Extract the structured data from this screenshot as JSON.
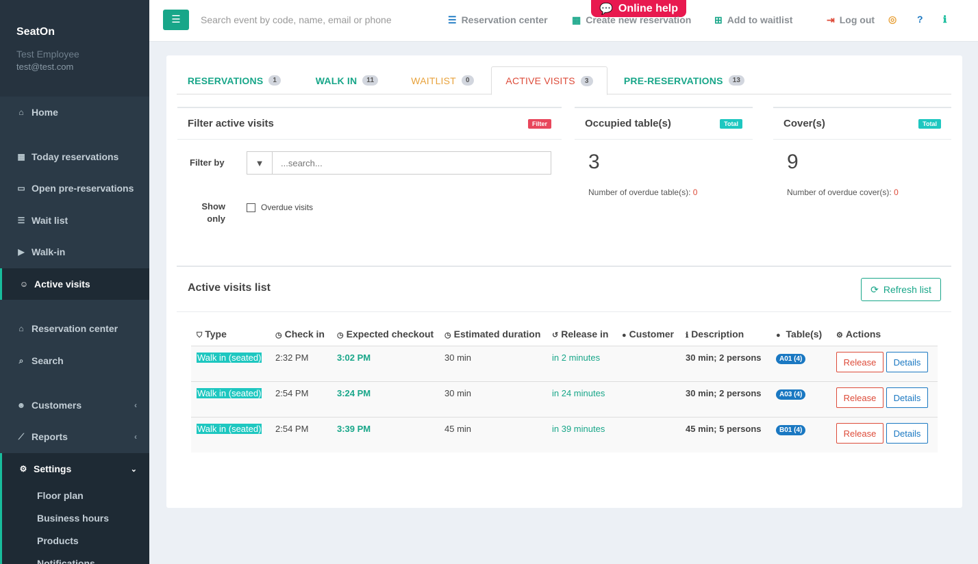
{
  "sidebar": {
    "app_name": "SeatOn",
    "user_role": "Test Employee",
    "user_email": "test@test.com",
    "items": [
      {
        "label": "Home",
        "icon": "home-icon"
      },
      {
        "label": "Today reservations",
        "icon": "calendar-icon"
      },
      {
        "label": "Open pre-reservations",
        "icon": "calendar-empty-icon"
      },
      {
        "label": "Wait list",
        "icon": "list-icon"
      },
      {
        "label": "Walk-in",
        "icon": "play-circle-icon"
      },
      {
        "label": "Active visits",
        "icon": "smile-icon"
      },
      {
        "label": "Reservation center",
        "icon": "bank-icon"
      },
      {
        "label": "Search",
        "icon": "search-icon"
      },
      {
        "label": "Customers",
        "icon": "users-icon"
      },
      {
        "label": "Reports",
        "icon": "line-chart-icon"
      }
    ],
    "settings": {
      "label": "Settings",
      "icon": "cogs-icon",
      "subitems": [
        "Floor plan",
        "Business hours",
        "Products",
        "Notifications"
      ]
    }
  },
  "topbar": {
    "search_placeholder": "Search event by code, name, email or phone",
    "online_help": "Online help",
    "reservation_center": "Reservation center",
    "create_reservation": "Create new reservation",
    "add_waitlist": "Add to waitlist",
    "log_out": "Log out"
  },
  "tabs": [
    {
      "label": "RESERVATIONS",
      "count": "1",
      "color": "#18a689"
    },
    {
      "label": "WALK IN",
      "count": "11",
      "color": "#18a689"
    },
    {
      "label": "WAITLIST",
      "count": "0",
      "color": "#e8a23b"
    },
    {
      "label": "ACTIVE VISITS",
      "count": "3",
      "color": "#dd4b39"
    },
    {
      "label": "PRE-RESERVATIONS",
      "count": "13",
      "color": "#18a689"
    }
  ],
  "filter_box": {
    "title": "Filter active visits",
    "badge": "Filter",
    "filter_by_label": "Filter by",
    "search_placeholder": "...search...",
    "show_only_label": "Show only",
    "overdue_checkbox": "Overdue visits"
  },
  "occupied": {
    "title": "Occupied table(s)",
    "badge": "Total",
    "value": "3",
    "overdue_label": "Number of overdue table(s):",
    "overdue_value": "0"
  },
  "covers": {
    "title": "Cover(s)",
    "badge": "Total",
    "value": "9",
    "overdue_label": "Number of overdue cover(s):",
    "overdue_value": "0"
  },
  "list": {
    "title": "Active visits list",
    "refresh": "Refresh list",
    "columns": [
      "Type",
      "Check in",
      "Expected checkout",
      "Estimated duration",
      "Release in",
      "Customer",
      "Description",
      "Table(s)",
      "Actions"
    ],
    "rows": [
      {
        "type": "Walk in (seated)",
        "check_in": "2:32 PM",
        "checkout": "3:02 PM",
        "duration": "30 min",
        "release_in": "in 2 minutes",
        "customer": "",
        "description": "30 min; 2 persons",
        "table": "A01 (4)",
        "release_btn": "Release",
        "details_btn": "Details"
      },
      {
        "type": "Walk in (seated)",
        "check_in": "2:54 PM",
        "checkout": "3:24 PM",
        "duration": "30 min",
        "release_in": "in 24 minutes",
        "customer": "",
        "description": "30 min; 2 persons",
        "table": "A03 (4)",
        "release_btn": "Release",
        "details_btn": "Details"
      },
      {
        "type": "Walk in (seated)",
        "check_in": "2:54 PM",
        "checkout": "3:39 PM",
        "duration": "45 min",
        "release_in": "in 39 minutes",
        "customer": "",
        "description": "45 min; 5 persons",
        "table": "B01 (4)",
        "release_btn": "Release",
        "details_btn": "Details"
      }
    ]
  }
}
